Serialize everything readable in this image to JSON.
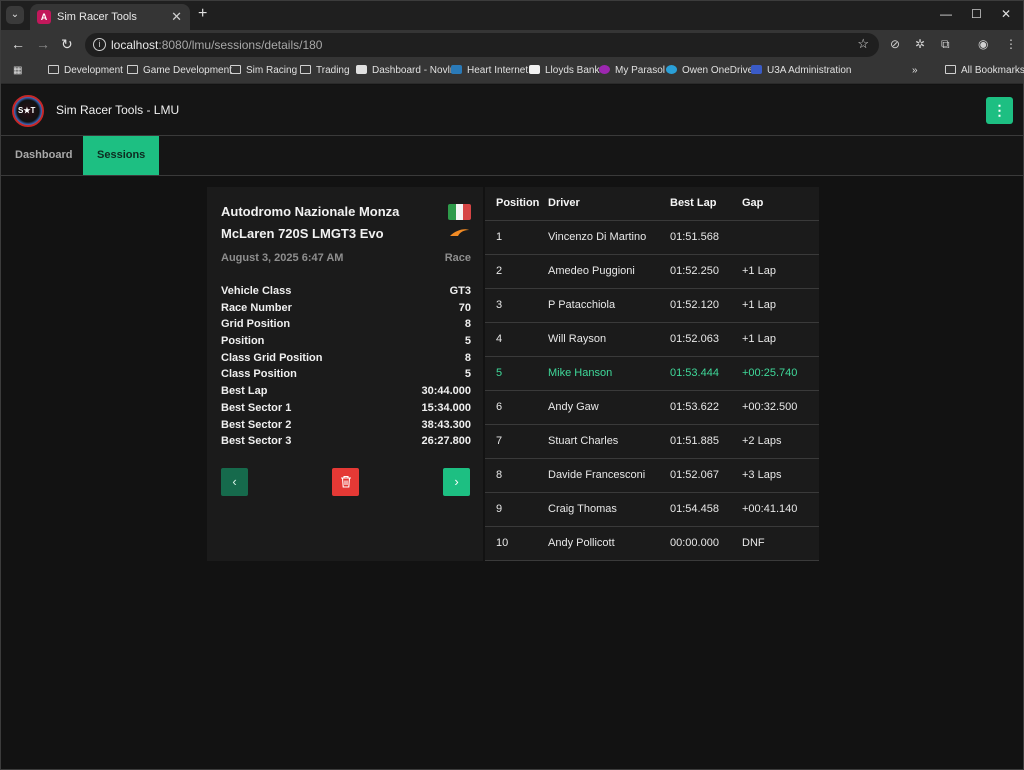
{
  "browser": {
    "tab_title": "Sim Racer Tools",
    "url_host": "localhost",
    "url_path": ":8080/lmu/sessions/details/180",
    "bookmarks": [
      {
        "label": "Development",
        "icon": "folder-icon"
      },
      {
        "label": "Game Development",
        "icon": "folder-icon"
      },
      {
        "label": "Sim Racing",
        "icon": "folder-icon"
      },
      {
        "label": "Trading",
        "icon": "folder-icon"
      },
      {
        "label": "Dashboard - Novlr",
        "icon": "book-icon"
      },
      {
        "label": "Heart Internet",
        "icon": "h-icon"
      },
      {
        "label": "Lloyds Bank",
        "icon": "horse-icon"
      },
      {
        "label": "My Parasol",
        "icon": "p-icon"
      },
      {
        "label": "Owen OneDrive",
        "icon": "cloud-icon"
      },
      {
        "label": "U3A Administration",
        "icon": "u3a-icon"
      }
    ],
    "all_bookmarks": "All Bookmarks"
  },
  "app": {
    "title": "Sim Racer Tools - LMU",
    "logo_text": "S★T",
    "nav": [
      "Dashboard",
      "Sessions"
    ],
    "active_nav": "Sessions",
    "accent_color": "#1dbf82",
    "delete_color": "#e53935"
  },
  "session": {
    "track": "Autodromo Nazionale Monza",
    "car": "McLaren 720S LMGT3 Evo",
    "date": "August 3, 2025 6:47 AM",
    "type": "Race",
    "flag": "italy-flag-icon",
    "stats": [
      {
        "label": "Vehicle Class",
        "value": "GT3"
      },
      {
        "label": "Race Number",
        "value": "70"
      },
      {
        "label": "Grid Position",
        "value": "8"
      },
      {
        "label": "Position",
        "value": "5"
      },
      {
        "label": "Class Grid Position",
        "value": "8"
      },
      {
        "label": "Class Position",
        "value": "5"
      },
      {
        "label": "Best Lap",
        "value": "30:44.000"
      },
      {
        "label": "Best Sector 1",
        "value": "15:34.000"
      },
      {
        "label": "Best Sector 2",
        "value": "38:43.300"
      },
      {
        "label": "Best Sector 3",
        "value": "26:27.800"
      }
    ]
  },
  "results": {
    "headers": [
      "Position",
      "Driver",
      "Best Lap",
      "Gap"
    ],
    "rows": [
      {
        "position": "1",
        "driver": "Vincenzo Di Martino",
        "best_lap": "01:51.568",
        "gap": ""
      },
      {
        "position": "2",
        "driver": "Amedeo Puggioni",
        "best_lap": "01:52.250",
        "gap": "+1 Lap"
      },
      {
        "position": "3",
        "driver": "P Patacchiola",
        "best_lap": "01:52.120",
        "gap": "+1 Lap"
      },
      {
        "position": "4",
        "driver": "Will Rayson",
        "best_lap": "01:52.063",
        "gap": "+1 Lap"
      },
      {
        "position": "5",
        "driver": "Mike Hanson",
        "best_lap": "01:53.444",
        "gap": "+00:25.740",
        "highlight": true
      },
      {
        "position": "6",
        "driver": "Andy Gaw",
        "best_lap": "01:53.622",
        "gap": "+00:32.500"
      },
      {
        "position": "7",
        "driver": "Stuart Charles",
        "best_lap": "01:51.885",
        "gap": "+2 Laps"
      },
      {
        "position": "8",
        "driver": "Davide Francesconi",
        "best_lap": "01:52.067",
        "gap": "+3 Laps"
      },
      {
        "position": "9",
        "driver": "Craig Thomas",
        "best_lap": "01:54.458",
        "gap": "+00:41.140"
      },
      {
        "position": "10",
        "driver": "Andy Pollicott",
        "best_lap": "00:00.000",
        "gap": "DNF"
      }
    ]
  }
}
